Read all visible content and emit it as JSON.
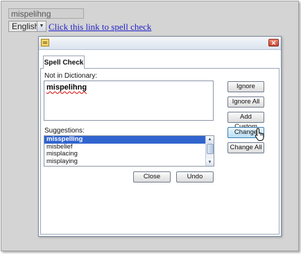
{
  "page": {
    "text_input_value": "mispelihng",
    "language_select": "English",
    "spell_check_link": "Click this link to spell check"
  },
  "dialog": {
    "tab_label": "Spell Check",
    "not_in_dictionary_label": "Not in Dictionary:",
    "misspelled_word": "mispelihng",
    "suggestions_label": "Suggestions:",
    "suggestions": [
      "misspelling",
      "misbelief",
      "misplacing",
      "misplaying"
    ],
    "selected_suggestion_index": 0,
    "buttons": {
      "ignore": "Ignore",
      "ignore_all": "Ignore All",
      "add_custom": "Add Custom",
      "change": "Change",
      "change_all": "Change All",
      "close": "Close",
      "undo": "Undo"
    }
  },
  "icons": {
    "app_icon": "notepad-icon",
    "close_icon": "close-icon",
    "cursor": "hand-pointer-icon"
  },
  "colors": {
    "selection": "#3164ce",
    "link": "#2323c8",
    "active_button": "#b8dff6"
  }
}
